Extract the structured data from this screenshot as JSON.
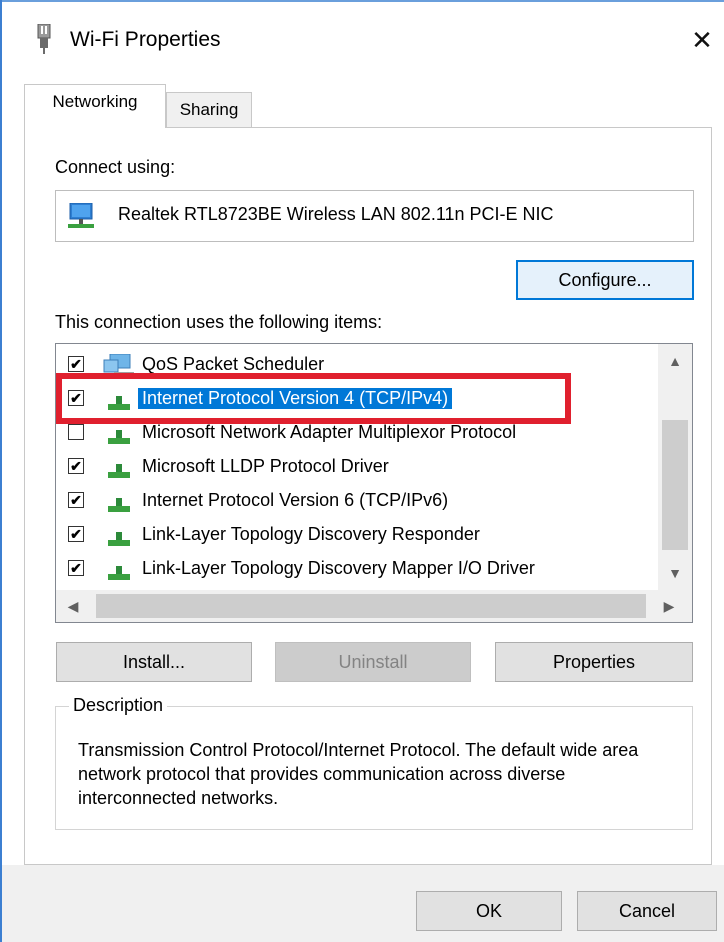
{
  "window": {
    "title": "Wi-Fi Properties",
    "close_glyph": "✕"
  },
  "tabs": [
    {
      "label": "Networking",
      "active": true
    },
    {
      "label": "Sharing",
      "active": false
    }
  ],
  "connect_using": {
    "label": "Connect using:",
    "adapter": "Realtek RTL8723BE Wireless LAN 802.11n PCI-E NIC",
    "configure_button": "Configure..."
  },
  "items": {
    "label": "This connection uses the following items:",
    "rows": [
      {
        "label": "QoS Packet Scheduler",
        "checked": true,
        "icon": "scheduler-icon"
      },
      {
        "label": "Internet Protocol Version 4 (TCP/IPv4)",
        "checked": true,
        "icon": "network-protocol-icon",
        "selected": true
      },
      {
        "label": "Microsoft Network Adapter Multiplexor Protocol",
        "checked": false,
        "icon": "network-protocol-icon"
      },
      {
        "label": "Microsoft LLDP Protocol Driver",
        "checked": true,
        "icon": "network-protocol-icon"
      },
      {
        "label": "Internet Protocol Version 6 (TCP/IPv6)",
        "checked": true,
        "icon": "network-protocol-icon"
      },
      {
        "label": "Link-Layer Topology Discovery Responder",
        "checked": true,
        "icon": "network-protocol-icon"
      },
      {
        "label": "Link-Layer Topology Discovery Mapper I/O Driver",
        "checked": true,
        "icon": "network-protocol-icon"
      }
    ]
  },
  "actions": {
    "install": "Install...",
    "uninstall": "Uninstall",
    "properties": "Properties"
  },
  "description": {
    "title": "Description",
    "text": "Transmission Control Protocol/Internet Protocol. The default wide area network protocol that provides communication across diverse interconnected networks."
  },
  "footer": {
    "ok": "OK",
    "cancel": "Cancel"
  },
  "colors": {
    "accent": "#0078d7",
    "highlight_box": "#e0202e",
    "window_border": "#3c7fd1"
  }
}
